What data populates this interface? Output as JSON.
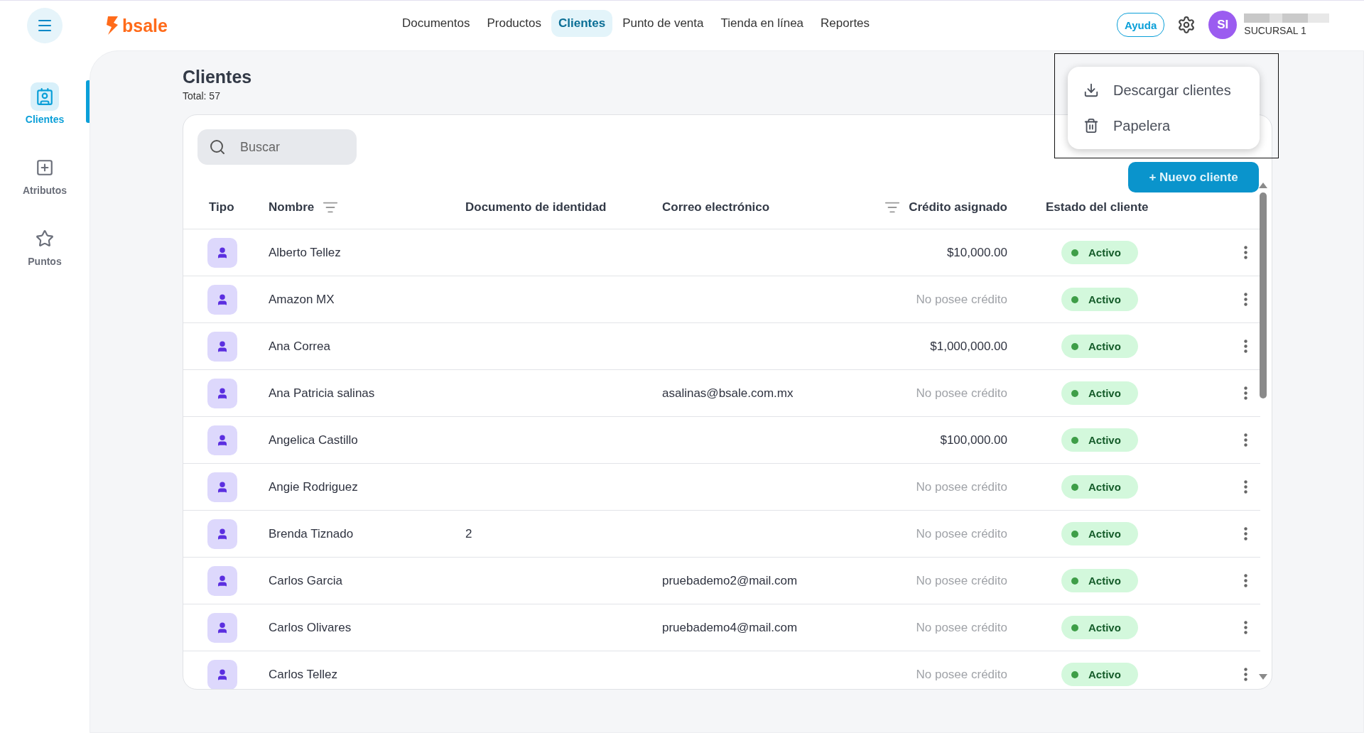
{
  "header": {
    "logo": "bsale",
    "nav": [
      {
        "label": "Documentos",
        "selected": false
      },
      {
        "label": "Productos",
        "selected": false
      },
      {
        "label": "Clientes",
        "selected": true
      },
      {
        "label": "Punto de venta",
        "selected": false
      },
      {
        "label": "Tienda en línea",
        "selected": false
      },
      {
        "label": "Reportes",
        "selected": false
      }
    ],
    "help": "Ayuda",
    "avatar": "SI",
    "branch": "SUCURSAL 1"
  },
  "sidebar": {
    "items": [
      {
        "label": "Clientes",
        "selected": true
      },
      {
        "label": "Atributos",
        "selected": false
      },
      {
        "label": "Puntos",
        "selected": false
      }
    ]
  },
  "page": {
    "title": "Clientes",
    "total": "Total: 57"
  },
  "search": {
    "placeholder": "Buscar"
  },
  "new_button": "+ Nuevo cliente",
  "menu": {
    "items": [
      {
        "label": "Descargar clientes"
      },
      {
        "label": "Papelera"
      }
    ]
  },
  "table": {
    "columns": [
      "Tipo",
      "Nombre",
      "Documento de identidad",
      "Correo electrónico",
      "Crédito asignado",
      "Estado del cliente"
    ],
    "rows": [
      {
        "name": "Alberto Tellez",
        "credit": "$10,000.00",
        "has_credit": true,
        "status": "Activo"
      },
      {
        "name": "Amazon MX",
        "credit": "No posee crédito",
        "has_credit": false,
        "status": "Activo"
      },
      {
        "name": "Ana Correa",
        "credit": "$1,000,000.00",
        "has_credit": true,
        "status": "Activo"
      },
      {
        "name": "Ana Patricia salinas",
        "email": "asalinas@bsale.com.mx",
        "credit": "No posee crédito",
        "has_credit": false,
        "status": "Activo"
      },
      {
        "name": "Angelica Castillo",
        "credit": "$100,000.00",
        "has_credit": true,
        "status": "Activo"
      },
      {
        "name": "Angie Rodriguez",
        "credit": "No posee crédito",
        "has_credit": false,
        "status": "Activo"
      },
      {
        "name": "Brenda Tiznado",
        "document": "2",
        "credit": "No posee crédito",
        "has_credit": false,
        "status": "Activo"
      },
      {
        "name": "Carlos Garcia",
        "email": "pruebademo2@mail.com",
        "credit": "No posee crédito",
        "has_credit": false,
        "status": "Activo"
      },
      {
        "name": "Carlos Olivares",
        "email": "pruebademo4@mail.com",
        "credit": "No posee crédito",
        "has_credit": false,
        "status": "Activo"
      },
      {
        "name": "Carlos Tellez",
        "credit": "No posee crédito",
        "has_credit": false,
        "status": "Activo"
      }
    ]
  }
}
